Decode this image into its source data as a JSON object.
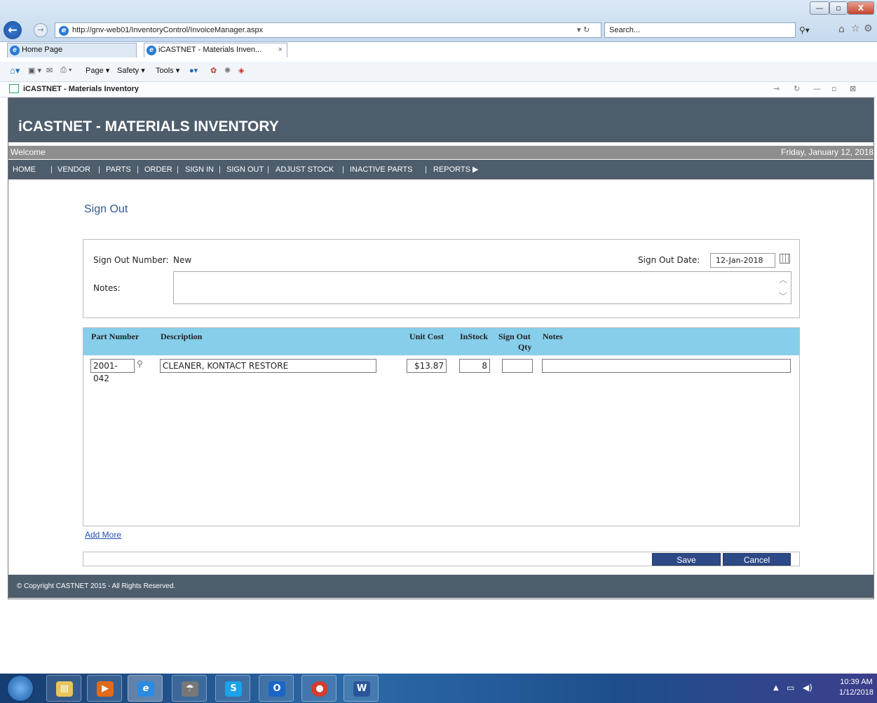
{
  "browser": {
    "url": "http://gnv-web01/InventoryControl/InvoiceManager.aspx",
    "search_placeholder": "Search...",
    "tabs": [
      {
        "label": "Home Page"
      },
      {
        "label": "iCASTNET - Materials Inven..."
      }
    ],
    "command_bar": [
      "Page ▾",
      "Safety ▾",
      "Tools ▾"
    ],
    "favorites_title": "iCASTNET - Materials Inventory",
    "minimize": "—",
    "restore": "▫",
    "close": "X"
  },
  "app": {
    "title": "iCASTNET - MATERIALS INVENTORY",
    "welcome": "Welcome",
    "date": "Friday, January 12, 2018",
    "menu": [
      "HOME",
      "VENDOR",
      "PARTS",
      "ORDER",
      "SIGN IN",
      "SIGN OUT",
      "ADJUST STOCK",
      "INACTIVE PARTS",
      "REPORTS"
    ]
  },
  "form": {
    "page_title": "Sign Out",
    "sign_out_number_label": "Sign Out Number:",
    "sign_out_number_value": "New",
    "sign_out_date_label": "Sign Out Date:",
    "sign_out_date_value": "12-Jan-2018",
    "notes_label": "Notes:"
  },
  "grid": {
    "headers": {
      "part_number": "Part Number",
      "description": "Description",
      "unit_cost": "Unit Cost",
      "instock": "InStock",
      "sign_out_qty_1": "Sign Out",
      "sign_out_qty_2": "Qty",
      "notes": "Notes"
    },
    "rows": [
      {
        "part_number": "2001-042",
        "description": "CLEANER, KONTACT RESTORE",
        "unit_cost": "$13.87",
        "instock": "8",
        "sign_out_qty": "",
        "notes": ""
      }
    ]
  },
  "actions": {
    "add_more": "Add More",
    "save": "Save",
    "cancel": "Cancel"
  },
  "footer": {
    "copyright": "© Copyright CASTNET 2015 - All Rights Reserved."
  },
  "taskbar": {
    "time": "10:39 AM",
    "date": "1/12/2018"
  }
}
